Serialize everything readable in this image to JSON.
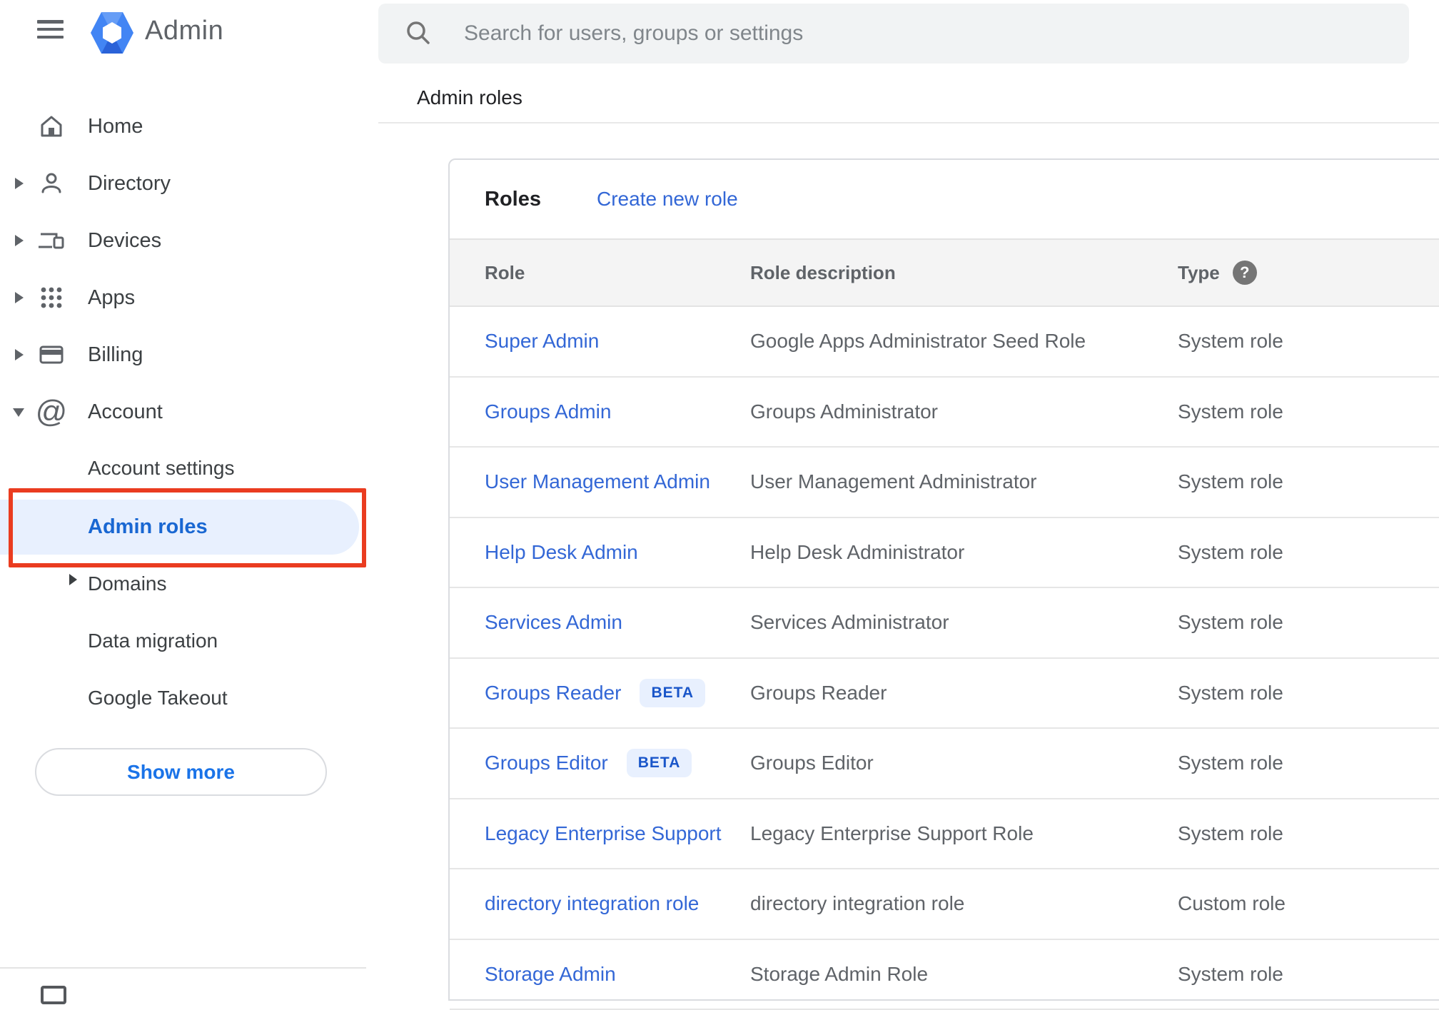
{
  "sidebar": {
    "brand": "Admin",
    "items": [
      {
        "label": "Home",
        "expandable": false
      },
      {
        "label": "Directory",
        "expandable": true,
        "expanded": false
      },
      {
        "label": "Devices",
        "expandable": true,
        "expanded": false
      },
      {
        "label": "Apps",
        "expandable": true,
        "expanded": false
      },
      {
        "label": "Billing",
        "expandable": true,
        "expanded": false
      },
      {
        "label": "Account",
        "expandable": true,
        "expanded": true
      }
    ],
    "account_children": [
      "Account settings",
      "Admin roles",
      "Domains",
      "Data migration",
      "Google Takeout"
    ],
    "selected_item": "Admin roles",
    "show_more_label": "Show more"
  },
  "search": {
    "placeholder": "Search for users, groups or settings"
  },
  "page": {
    "title": "Admin roles"
  },
  "card": {
    "title": "Roles",
    "create_link": "Create new role",
    "beta_label": "BETA",
    "columns": [
      "Role",
      "Role description",
      "Type"
    ],
    "rows": [
      {
        "role": "Super Admin",
        "beta": false,
        "description": "Google Apps Administrator Seed Role",
        "type": "System role"
      },
      {
        "role": "Groups Admin",
        "beta": false,
        "description": "Groups Administrator",
        "type": "System role"
      },
      {
        "role": "User Management Admin",
        "beta": false,
        "description": "User Management Administrator",
        "type": "System role"
      },
      {
        "role": "Help Desk Admin",
        "beta": false,
        "description": "Help Desk Administrator",
        "type": "System role"
      },
      {
        "role": "Services Admin",
        "beta": false,
        "description": "Services Administrator",
        "type": "System role"
      },
      {
        "role": "Groups Reader",
        "beta": true,
        "description": "Groups Reader",
        "type": "System role"
      },
      {
        "role": "Groups Editor",
        "beta": true,
        "description": "Groups Editor",
        "type": "System role"
      },
      {
        "role": "Legacy Enterprise Support",
        "beta": false,
        "description": "Legacy Enterprise Support Role",
        "type": "System role"
      },
      {
        "role": "directory integration role",
        "beta": false,
        "description": "directory integration role",
        "type": "Custom role"
      },
      {
        "role": "Storage Admin",
        "beta": false,
        "description": "Storage Admin Role",
        "type": "System role"
      }
    ]
  },
  "colors": {
    "accent_red": "#ea3c20",
    "link_blue": "#3367d6",
    "selected_blue": "#1967d2",
    "show_more_blue": "#1a73e8",
    "pill_bg": "#e8f0fe",
    "beta_bg": "#e8f0fe",
    "beta_text": "#1a56c9",
    "logo_blue": "#4285f4"
  }
}
